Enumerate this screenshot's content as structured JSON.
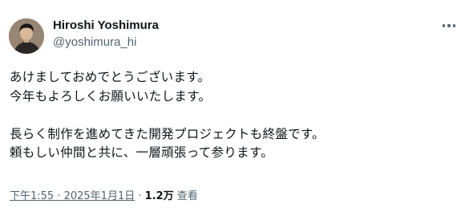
{
  "author": {
    "display_name": "Hiroshi Yoshimura",
    "handle": "@yoshimura_hi"
  },
  "tweet": {
    "lines": [
      "あけましておめでとうございます。",
      "今年もよろしくお願いいたします。",
      "",
      "長らく制作を進めてきた開発プロジェクトも終盤です。",
      "頼もしい仲間と共に、一層頑張って参ります。"
    ]
  },
  "meta": {
    "timestamp": "下午1:55 · 2025年1月1日",
    "separator": " · ",
    "views_count": "1.2万",
    "views_label": " 查看"
  },
  "icons": {
    "more": "more-horizontal-icon"
  },
  "colors": {
    "text_primary": "#0f1419",
    "text_secondary": "#536471",
    "background": "#ffffff"
  }
}
